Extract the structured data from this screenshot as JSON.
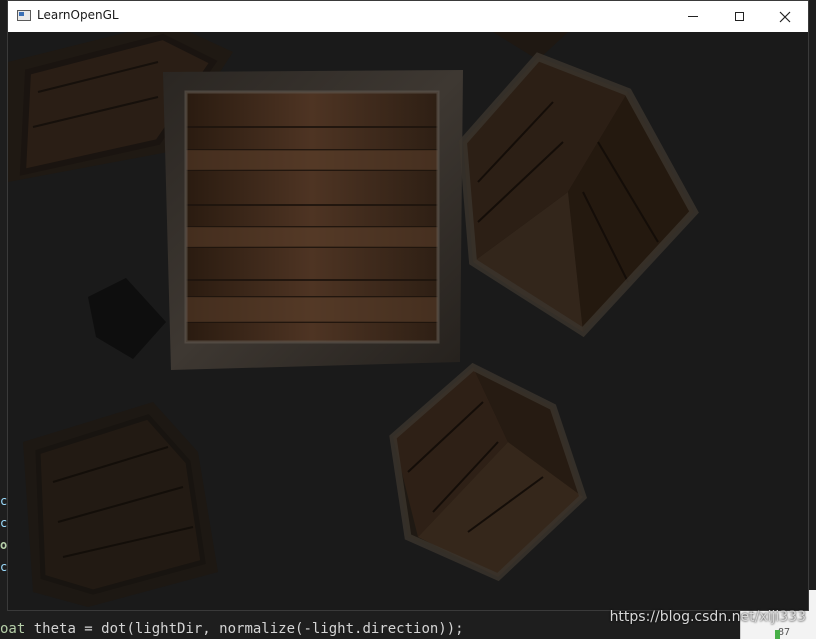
{
  "window": {
    "title": "LearnOpenGL",
    "controls": {
      "minimize": "minimize",
      "maximize": "maximize",
      "close": "close"
    }
  },
  "scene": {
    "description": "wooden crates rendered with spotlight",
    "crate_texture_colors": {
      "plank": "#4a3322",
      "plank_dark": "#2b1c12",
      "frame": "#3a342e"
    }
  },
  "editor_fragments": {
    "gutter": [
      "c",
      "c",
      "o",
      "c"
    ],
    "bottom_line_keyword": "oat",
    "bottom_line_rest": " theta = dot(lightDir, normalize(-light.direction));",
    "minimap_number": "87"
  },
  "watermark": "https://blog.csdn.net/xiji333"
}
